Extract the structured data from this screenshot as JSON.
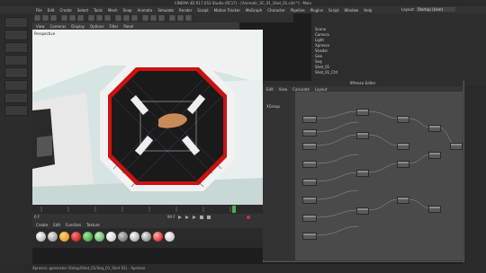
{
  "app": {
    "title": "CINEMA 4D R17.053 Studio (RC17) - [Animatic_SC_01_Shot_01.c4d *] - Main",
    "layout_label": "Layout:",
    "layout_value": "Startup (User)"
  },
  "menu": [
    "File",
    "Edit",
    "Create",
    "Select",
    "Tools",
    "Mesh",
    "Snap",
    "Animate",
    "Simulate",
    "Render",
    "Sculpt",
    "Motion Tracker",
    "MoGraph",
    "Character",
    "Pipeline",
    "Plugins",
    "Script",
    "Window",
    "Help"
  ],
  "viewport": {
    "menu": [
      "View",
      "Cameras",
      "Display",
      "Options",
      "Filter",
      "Panel"
    ],
    "label": "Perspective"
  },
  "timeline": {
    "frame_start": "0 F",
    "frame_end": "90 F",
    "current": "0 F"
  },
  "material_bar": {
    "menu": [
      "Create",
      "Edit",
      "Function",
      "Texture"
    ]
  },
  "status": "Xpresso: generator (Setup/Shot_01/Seq_01_Shot 01) - Xpresso",
  "object_manager": {
    "items": [
      "Scene",
      "Camera",
      "Light",
      "Xpresso",
      "Shader",
      "Geo",
      "Seq",
      "Shot_01",
      "Shot_01_Ctrl"
    ]
  },
  "xpresso": {
    "title": "XPresso Editor",
    "menu": [
      "Edit",
      "View",
      "Calculate",
      "Layout"
    ],
    "panel_label": "XGroup",
    "root_node": "XGroup"
  }
}
